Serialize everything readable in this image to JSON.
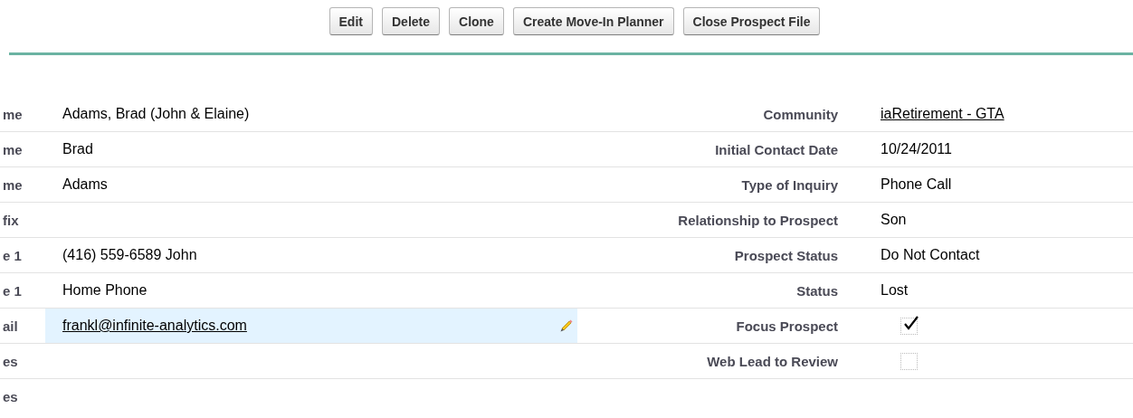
{
  "buttons": [
    "Edit",
    "Delete",
    "Clone",
    "Create Move-In Planner",
    "Close Prospect File"
  ],
  "left_fields": [
    {
      "label": "me",
      "value": "Adams, Brad (John & Elaine)",
      "kind": "text",
      "hovered": false
    },
    {
      "label": "me",
      "value": "Brad",
      "kind": "text",
      "hovered": false
    },
    {
      "label": "me",
      "value": "Adams",
      "kind": "text",
      "hovered": false
    },
    {
      "label": "fix",
      "kind": "text",
      "hovered": false
    },
    {
      "label": "e 1",
      "value": "(416) 559-6589 John",
      "kind": "text",
      "hovered": false
    },
    {
      "label": "e 1",
      "value": "Home Phone",
      "kind": "text",
      "hovered": false
    },
    {
      "label": "ail",
      "value": "frankl@infinite-analytics.com",
      "kind": "link",
      "hovered": true
    },
    {
      "label": "es",
      "kind": "text",
      "hovered": false
    },
    {
      "label": "es",
      "kind": "text",
      "hovered": false
    }
  ],
  "right_fields": [
    {
      "label": "Community",
      "value": "iaRetirement - GTA",
      "kind": "link"
    },
    {
      "label": "Initial Contact Date",
      "value": "10/24/2011",
      "kind": "text"
    },
    {
      "label": "Type of Inquiry",
      "value": "Phone Call",
      "kind": "text"
    },
    {
      "label": "Relationship to Prospect",
      "value": "Son",
      "kind": "text"
    },
    {
      "label": "Prospect Status",
      "value": "Do Not Contact",
      "kind": "text"
    },
    {
      "label": "Status",
      "value": "Lost",
      "kind": "text"
    },
    {
      "label": "Focus Prospect",
      "kind": "checkbox",
      "checked": true
    },
    {
      "label": "Web Lead to Review",
      "kind": "checkbox",
      "checked": false
    }
  ]
}
